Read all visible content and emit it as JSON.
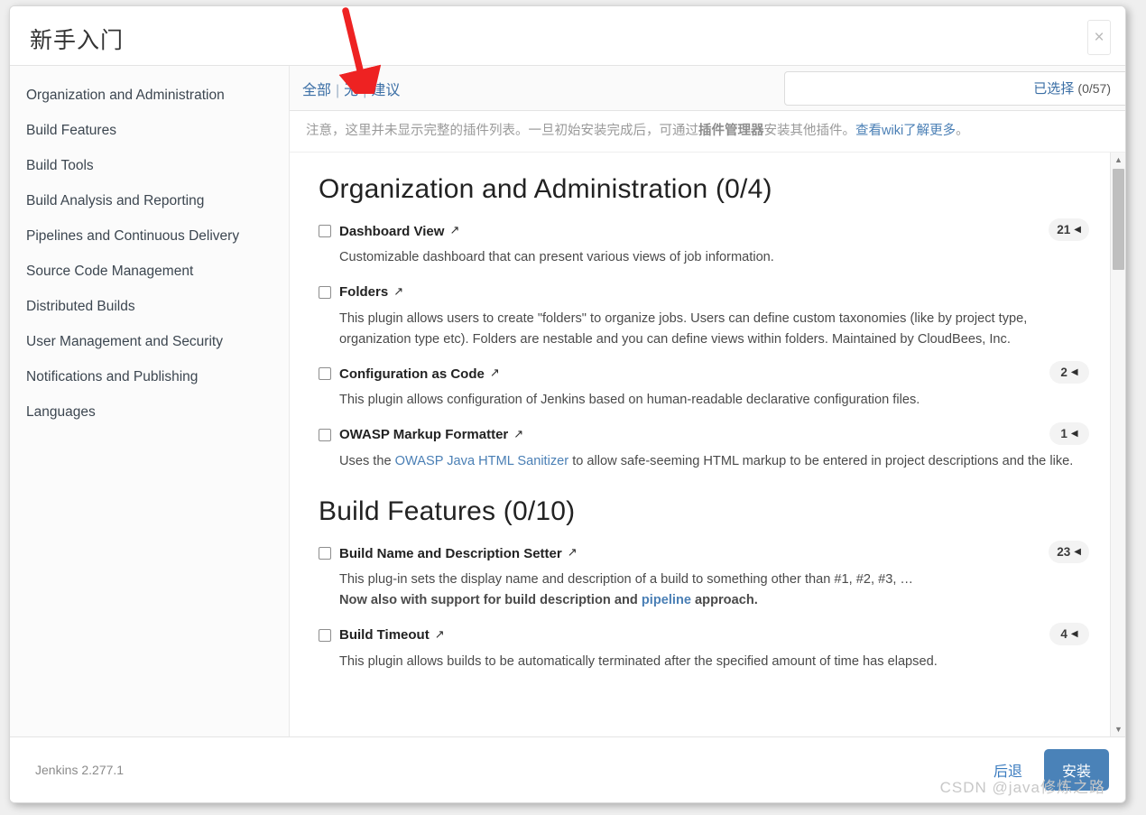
{
  "dialog": {
    "title": "新手入门",
    "close_icon": "close-icon"
  },
  "sidebar": {
    "categories": [
      "Organization and Administration",
      "Build Features",
      "Build Tools",
      "Build Analysis and Reporting",
      "Pipelines and Continuous Delivery",
      "Source Code Management",
      "Distributed Builds",
      "User Management and Security",
      "Notifications and Publishing",
      "Languages"
    ]
  },
  "toolbar": {
    "filter_all": "全部",
    "filter_none": "无",
    "filter_suggested": "建议",
    "separator": "|",
    "search_value": "",
    "search_placeholder": "",
    "search_clear_icon": "clear-icon",
    "selected_label": "已选择",
    "selected_count": "(0/57)"
  },
  "notice": {
    "text_1": "注意，这里并未显示完整的插件列表。一旦初始安装完成后，可通过",
    "bold": "插件管理器",
    "text_2": "安装其他插件。",
    "link": "查看wiki了解更多",
    "text_3": "。"
  },
  "sections": [
    {
      "title": "Organization and Administration (0/4)",
      "plugins": [
        {
          "name": "Dashboard View",
          "version": "21",
          "checked": false,
          "desc_parts": [
            {
              "type": "text",
              "value": "Customizable dashboard that can present various views of job information."
            }
          ]
        },
        {
          "name": "Folders",
          "version": "",
          "checked": false,
          "desc_parts": [
            {
              "type": "text",
              "value": "This plugin allows users to create \"folders\" to organize jobs. Users can define custom taxonomies (like by project type, organization type etc). Folders are nestable and you can define views within folders. Maintained by CloudBees, Inc."
            }
          ]
        },
        {
          "name": "Configuration as Code",
          "version": "2",
          "checked": false,
          "desc_parts": [
            {
              "type": "text",
              "value": "This plugin allows configuration of Jenkins based on human-readable declarative configuration files."
            }
          ]
        },
        {
          "name": "OWASP Markup Formatter",
          "version": "1",
          "checked": false,
          "desc_parts": [
            {
              "type": "text",
              "value": "Uses the "
            },
            {
              "type": "link",
              "value": "OWASP Java HTML Sanitizer"
            },
            {
              "type": "text",
              "value": " to allow safe-seeming HTML markup to be entered in project descriptions and the like."
            }
          ]
        }
      ]
    },
    {
      "title": "Build Features (0/10)",
      "plugins": [
        {
          "name": "Build Name and Description Setter",
          "version": "23",
          "checked": false,
          "desc_parts": [
            {
              "type": "text",
              "value": "This plug-in sets the display name and description of a build to something other than #1, #2, #3, …"
            },
            {
              "type": "break",
              "value": ""
            },
            {
              "type": "strong",
              "value": "Now also with support for build description and "
            },
            {
              "type": "link-strong",
              "value": "pipeline"
            },
            {
              "type": "strong",
              "value": " approach."
            }
          ]
        },
        {
          "name": "Build Timeout",
          "version": "4",
          "checked": false,
          "desc_parts": [
            {
              "type": "text",
              "value": "This plugin allows builds to be automatically terminated after the specified amount of time has elapsed."
            }
          ]
        }
      ]
    }
  ],
  "icons": {
    "external_link": "↗",
    "badge_triangle": "◀",
    "scroll_up": "▲",
    "scroll_down": "▼",
    "close": "×",
    "clear": "✕"
  },
  "footer": {
    "version": "Jenkins 2.277.1",
    "back_label": "后退",
    "install_label": "安装",
    "watermark": "CSDN @java修炼之路"
  },
  "colors": {
    "accent_blue": "#4a82b8",
    "link_blue": "#3a6ea5",
    "annotation_red": "#ee2222",
    "badge_bg": "#f3f3f3"
  }
}
